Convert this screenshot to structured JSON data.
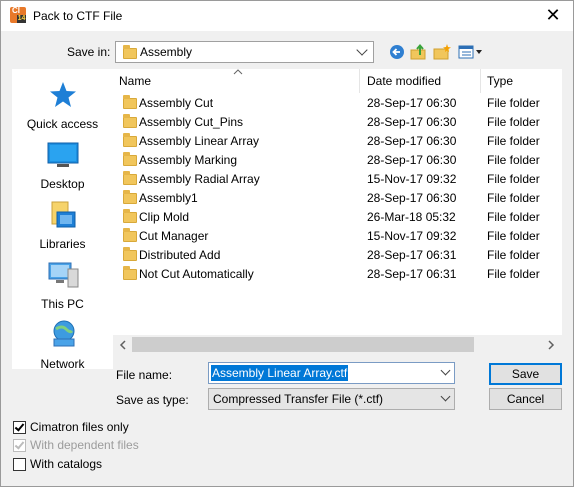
{
  "window": {
    "title": "Pack to CTF File",
    "app_icon_text": "CI",
    "app_icon_sub": "14",
    "close_symbol": "✕"
  },
  "toolbar": {
    "save_in_label": "Save in:",
    "save_in_value": "Assembly",
    "buttons": [
      "back-icon",
      "up-folder-icon",
      "new-folder-icon",
      "view-menu-icon"
    ]
  },
  "places": [
    {
      "label": "Quick access",
      "icon": "star-icon"
    },
    {
      "label": "Desktop",
      "icon": "desktop-icon"
    },
    {
      "label": "Libraries",
      "icon": "libraries-icon"
    },
    {
      "label": "This PC",
      "icon": "computer-icon"
    },
    {
      "label": "Network",
      "icon": "network-icon"
    }
  ],
  "filelist": {
    "columns": {
      "name": "Name",
      "date": "Date modified",
      "type": "Type"
    },
    "rows": [
      {
        "name": "Assembly Cut",
        "date": "28-Sep-17 06:30",
        "type": "File folder"
      },
      {
        "name": "Assembly Cut_Pins",
        "date": "28-Sep-17 06:30",
        "type": "File folder"
      },
      {
        "name": "Assembly Linear Array",
        "date": "28-Sep-17 06:30",
        "type": "File folder"
      },
      {
        "name": "Assembly Marking",
        "date": "28-Sep-17 06:30",
        "type": "File folder"
      },
      {
        "name": "Assembly Radial Array",
        "date": "15-Nov-17 09:32",
        "type": "File folder"
      },
      {
        "name": "Assembly1",
        "date": "28-Sep-17 06:30",
        "type": "File folder"
      },
      {
        "name": "Clip Mold",
        "date": "26-Mar-18 05:32",
        "type": "File folder"
      },
      {
        "name": "Cut Manager",
        "date": "15-Nov-17 09:32",
        "type": "File folder"
      },
      {
        "name": "Distributed Add",
        "date": "28-Sep-17 06:31",
        "type": "File folder"
      },
      {
        "name": "Not Cut Automatically",
        "date": "28-Sep-17 06:31",
        "type": "File folder"
      }
    ]
  },
  "form": {
    "file_name_label": "File name:",
    "file_name_value": "Assembly Linear Array.ctf",
    "save_as_type_label": "Save as type:",
    "save_as_type_value": "Compressed Transfer File (*.ctf)",
    "save_button": "Save",
    "cancel_button": "Cancel"
  },
  "options": [
    {
      "label": "Cimatron files only",
      "checked": true,
      "disabled": false
    },
    {
      "label": "With dependent files",
      "checked": true,
      "disabled": true
    },
    {
      "label": "With catalogs",
      "checked": false,
      "disabled": false
    }
  ],
  "colors": {
    "selection": "#0078d7",
    "folder": "#f1c65c",
    "accent_star": "#1e7fd6"
  }
}
